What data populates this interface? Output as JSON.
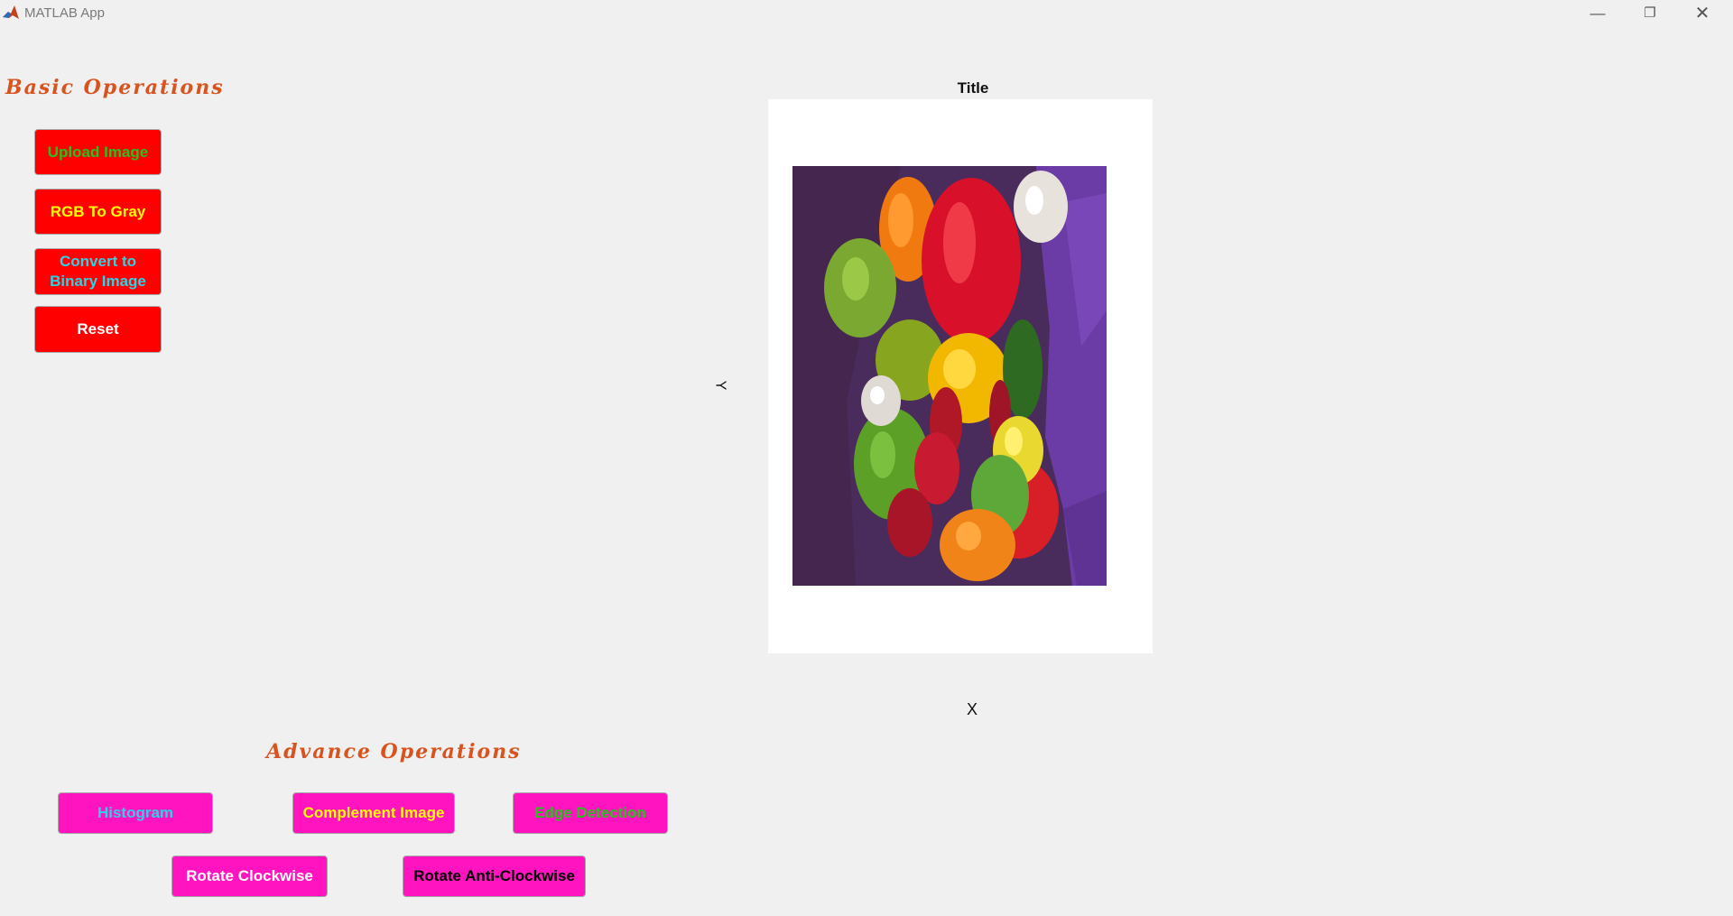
{
  "window": {
    "title": "MATLAB App",
    "minimize_icon": "minimize-icon",
    "maximize_icon": "restore-icon",
    "close_icon": "close-icon"
  },
  "basic": {
    "heading": "Basic Operations",
    "buttons": [
      {
        "label": "Upload Image",
        "color": "#22c41a"
      },
      {
        "label": "RGB To Gray",
        "color": "#ffff00"
      },
      {
        "label": "Convert to Binary Image",
        "color": "#29d4e6"
      },
      {
        "label": "Reset",
        "color": "#ffffff"
      }
    ],
    "button_bg": "#ff0000"
  },
  "advance": {
    "heading": "Advance Operations",
    "buttons": [
      {
        "label": "Histogram",
        "color": "#29d4e6"
      },
      {
        "label": "Complement Image",
        "color": "#ffff00"
      },
      {
        "label": "Edge Detection",
        "color": "#22c41a"
      },
      {
        "label": "Rotate Clockwise",
        "color": "#ffffff"
      },
      {
        "label": "Rotate Anti-Clockwise",
        "color": "#000000"
      }
    ],
    "button_bg": "#ff14c0"
  },
  "axes": {
    "title": "Title",
    "xlabel": "X",
    "ylabel": "Y"
  },
  "heading_color": "#d9531e"
}
